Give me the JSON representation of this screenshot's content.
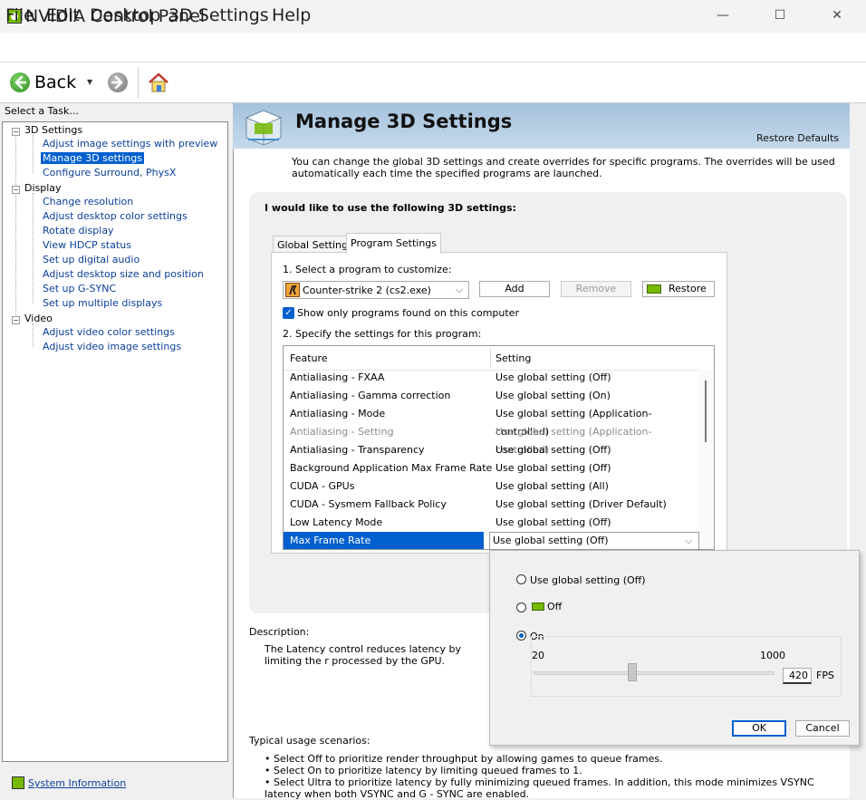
{
  "window": {
    "title": "NVIDIA Control Panel",
    "min_glyph": "—",
    "max_glyph": "☐",
    "close_glyph": "✕"
  },
  "menu": [
    "File",
    "Edit",
    "Desktop",
    "3D Settings",
    "Help"
  ],
  "toolbar": {
    "back_label": "Back",
    "dropdown_glyph": "▼"
  },
  "sidebar": {
    "task_label": "Select a Task...",
    "groups": [
      {
        "label": "3D Settings",
        "items": [
          "Adjust image settings with preview",
          "Manage 3D settings",
          "Configure Surround, PhysX"
        ]
      },
      {
        "label": "Display",
        "items": [
          "Change resolution",
          "Adjust desktop color settings",
          "Rotate display",
          "View HDCP status",
          "Set up digital audio",
          "Adjust desktop size and position",
          "Set up G-SYNC",
          "Set up multiple displays"
        ]
      },
      {
        "label": "Video",
        "items": [
          "Adjust video color settings",
          "Adjust video image settings"
        ]
      }
    ],
    "selected_item": "Manage 3D settings",
    "system_info_link": "System Information"
  },
  "main": {
    "title": "Manage 3D Settings",
    "restore_defaults": "Restore Defaults",
    "intro": "You can change the global 3D settings and create overrides for specific programs. The overrides will be used automatically each time the specified programs are launched.",
    "settings_heading": "I would like to use the following 3D settings:",
    "tabs": [
      {
        "label": "Global Settings",
        "active": false
      },
      {
        "label": "Program Settings",
        "active": true
      }
    ],
    "step1_label": "1. Select a program to customize:",
    "program_selected": "Counter-strike 2 (cs2.exe)",
    "buttons": {
      "add": "Add",
      "remove": "Remove",
      "restore": "Restore"
    },
    "show_only_label": "Show only programs found on this computer",
    "show_only_checked": true,
    "step2_label": "2. Specify the settings for this program:",
    "table": {
      "headers": [
        "Feature",
        "Setting"
      ],
      "rows": [
        {
          "feature": "Antialiasing - FXAA",
          "setting": "Use global setting (Off)"
        },
        {
          "feature": "Antialiasing - Gamma correction",
          "setting": "Use global setting (On)"
        },
        {
          "feature": "Antialiasing - Mode",
          "setting": "Use global setting (Application-controlled)"
        },
        {
          "feature": "Antialiasing - Setting",
          "setting": "Use global setting (Application-controlled)",
          "disabled": true
        },
        {
          "feature": "Antialiasing - Transparency",
          "setting": "Use global setting (Off)"
        },
        {
          "feature": "Background Application Max Frame Rate",
          "setting": "Use global setting (Off)"
        },
        {
          "feature": "CUDA - GPUs",
          "setting": "Use global setting (All)"
        },
        {
          "feature": "CUDA - Sysmem Fallback Policy",
          "setting": "Use global setting (Driver Default)"
        },
        {
          "feature": "Low Latency Mode",
          "setting": "Use global setting (Off)"
        },
        {
          "feature": "Max Frame Rate",
          "setting": "Use global setting (Off)",
          "selected": true
        }
      ]
    },
    "description_label": "Description:",
    "description_text": "The Latency control reduces latency by limiting the r processed by the GPU.",
    "usage_label": "Typical usage scenarios:",
    "usage_items": [
      "• Select Off to prioritize render throughput by allowing games to queue frames.",
      "• Select On to prioritize latency by limiting queued frames to 1.",
      "• Select Ultra to prioritize latency by fully minimizing queued frames. In addition, this mode minimizes VSYNC latency when both VSYNC and G - SYNC are enabled."
    ]
  },
  "popup": {
    "options": [
      {
        "label": "Use global setting (Off)",
        "checked": false
      },
      {
        "label": "Off",
        "checked": false
      },
      {
        "label": "On",
        "checked": true
      }
    ],
    "slider": {
      "min_label": "20",
      "max_label": "1000",
      "min": 20,
      "max": 1000,
      "value": 420,
      "value_text": "420",
      "unit": "FPS"
    },
    "ok": "OK",
    "cancel": "Cancel"
  }
}
